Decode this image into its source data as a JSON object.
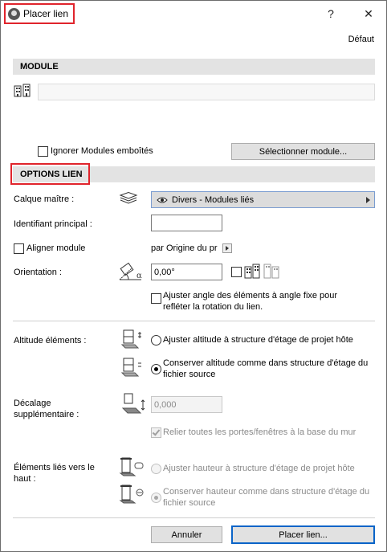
{
  "window": {
    "title": "Placer lien",
    "help_label": "?",
    "close_label": "✕"
  },
  "toolbar": {
    "default_label": "Défaut"
  },
  "module": {
    "header": "MODULE",
    "path_value": "",
    "ignore_nested_label": "Ignorer Modules emboîtés",
    "select_button": "Sélectionner module..."
  },
  "options": {
    "header": "OPTIONS LIEN",
    "master_layer_label": "Calque maître :",
    "master_layer_value": "Divers - Modules liés",
    "main_id_label": "Identifiant principal :",
    "main_id_value": "",
    "align_module_label": "Aligner module",
    "align_by_label": "par Origine du pr",
    "orientation_label": "Orientation :",
    "orientation_value": "0,00°",
    "adjust_angle_label": "Ajuster angle des éléments à angle fixe pour refléter la rotation du lien."
  },
  "altitude": {
    "label": "Altitude éléments :",
    "option_adjust": "Ajuster altitude à structure d'étage de projet hôte",
    "option_keep": "Conserver altitude comme dans structure d'étage du fichier source",
    "selected": "keep"
  },
  "offset": {
    "label": "Décalage supplémentaire :",
    "value": "0,000",
    "doors_label": "Relier toutes les portes/fenêtres à la base du mur"
  },
  "linked_top": {
    "label": "Éléments liés vers le haut :",
    "option_adjust": "Ajuster hauteur à structure d'étage de projet hôte",
    "option_keep": "Conserver hauteur comme dans structure d'étage du fichier source",
    "selected": "keep"
  },
  "footer": {
    "cancel": "Annuler",
    "place": "Placer lien..."
  },
  "colors": {
    "highlight_red": "#e0242c",
    "section_gray": "#e3e3e3",
    "primary_blue": "#0a64c8"
  }
}
